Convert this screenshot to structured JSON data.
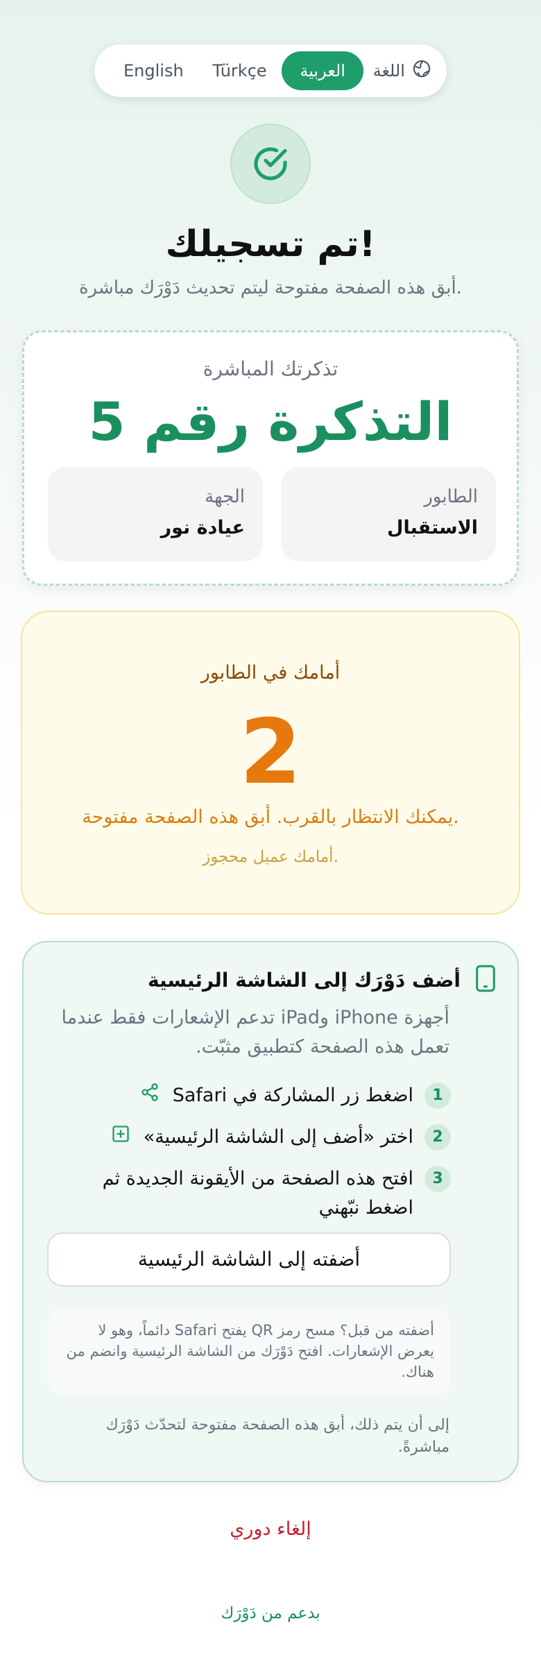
{
  "language_switcher": {
    "label": "اللغة",
    "icon": "globe-icon",
    "options": [
      "English",
      "Türkçe",
      "العربية"
    ],
    "selected": "العربية"
  },
  "header": {
    "icon": "check-circle-icon",
    "title": "تم تسجيلك!",
    "subtitle": "أبق هذه الصفحة مفتوحة ليتم تحديث دَوْرَك مباشرة."
  },
  "ticket": {
    "label": "تذكرتك المباشرة",
    "number": "التذكرة رقم 5",
    "queue_key": "الطابور",
    "queue_value": "الاستقبال",
    "destination_key": "الجهة",
    "destination_value": "عيادة نور"
  },
  "queue_status": {
    "label": "أمامك في الطابور",
    "count": "2",
    "message": "يمكنك الانتظار بالقرب. أبق هذه الصفحة مفتوحة.",
    "note": "أمامك عميل محجوز."
  },
  "home_screen": {
    "icon": "phone-icon",
    "title": "أضف دَوْرَك إلى الشاشة الرئيسية",
    "description": "أجهزة iPhone وiPad تدعم الإشعارات فقط عندما تعمل هذه الصفحة كتطبيق مثبّت.",
    "steps": [
      {
        "num": "1",
        "text": "اضغط زر المشاركة في Safari",
        "icon": "share-icon"
      },
      {
        "num": "2",
        "text": "اختر «أضف إلى الشاشة الرئيسية»",
        "icon": "plus-square-icon"
      },
      {
        "num": "3",
        "text": "افتح هذه الصفحة من الأيقونة الجديدة ثم اضغط نبّهني",
        "icon": ""
      }
    ],
    "button_label": "أضفته إلى الشاشة الرئيسية",
    "tip": "أضفته من قبل؟ مسح رمز QR يفتح Safari دائماً، وهو لا يعرض الإشعارات. افتح دَوْرَك من الشاشة الرئيسية وانضم من هناك.",
    "footer_note": "إلى أن يتم ذلك، أبق هذه الصفحة مفتوحة لتحدّث دَوْرَك مباشرةً."
  },
  "cancel_label": "إلغاء دوري",
  "powered_by": "بدعم من دَوْرَك",
  "colors": {
    "brand_green": "#1f9d6b",
    "queue_orange": "#e6790d",
    "cancel_red": "#c41e2c",
    "queue_bg": "#fffbea"
  }
}
